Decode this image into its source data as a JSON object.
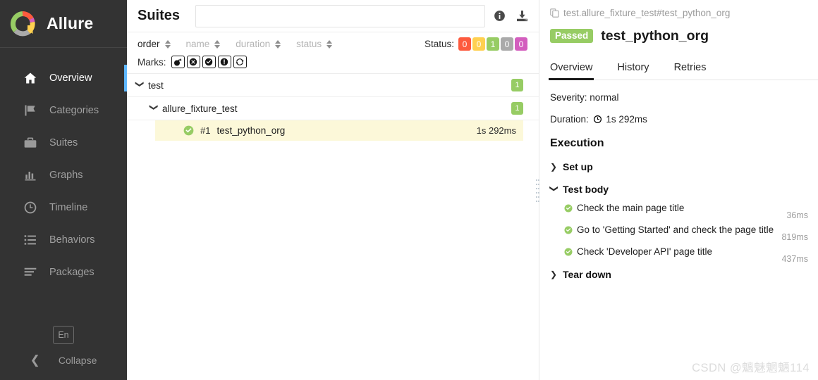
{
  "sidebar": {
    "brand": "Allure",
    "logo_colors": [
      "#97cc64",
      "#fd5a3e",
      "#d35ebe",
      "#ffd050",
      "#aaaaaa"
    ],
    "items": [
      {
        "label": "Overview",
        "icon": "home-icon",
        "active": false
      },
      {
        "label": "Categories",
        "icon": "flag-icon",
        "active": false
      },
      {
        "label": "Suites",
        "icon": "briefcase-icon",
        "active": true
      },
      {
        "label": "Graphs",
        "icon": "bar-chart-icon",
        "active": false
      },
      {
        "label": "Timeline",
        "icon": "clock-icon",
        "active": false
      },
      {
        "label": "Behaviors",
        "icon": "list-icon",
        "active": false
      },
      {
        "label": "Packages",
        "icon": "layers-icon",
        "active": false
      }
    ],
    "language_button": "En",
    "collapse_label": "Collapse",
    "collapse_icon": "chevron-left-icon",
    "active_indicator_color": "#5fb8ff"
  },
  "middle": {
    "title": "Suites",
    "search": {
      "value": "",
      "placeholder": ""
    },
    "info_icon": "info-circle-icon",
    "download_icon": "download-icon",
    "sorters": [
      {
        "label": "order",
        "active": true
      },
      {
        "label": "name",
        "active": false
      },
      {
        "label": "duration",
        "active": false
      },
      {
        "label": "status",
        "active": false
      }
    ],
    "status_label": "Status:",
    "status_badges": [
      {
        "count": "0",
        "color": "#fd5a3e",
        "name": "failed"
      },
      {
        "count": "0",
        "color": "#ffd050",
        "name": "broken"
      },
      {
        "count": "1",
        "color": "#97cc64",
        "name": "passed"
      },
      {
        "count": "0",
        "color": "#aaaaaa",
        "name": "skipped"
      },
      {
        "count": "0",
        "color": "#d35ebe",
        "name": "unknown"
      }
    ],
    "marks_label": "Marks:",
    "marks": [
      {
        "icon": "bomb-icon"
      },
      {
        "icon": "x-circle-icon"
      },
      {
        "icon": "check-circle-icon"
      },
      {
        "icon": "exclamation-circle-icon"
      },
      {
        "icon": "retry-icon"
      }
    ],
    "tree": {
      "suite": {
        "name": "test",
        "count": "1",
        "expanded": true
      },
      "child": {
        "name": "allure_fixture_test",
        "count": "1",
        "expanded": true
      },
      "leaf": {
        "index": "#1",
        "name": "test_python_org",
        "duration": "1s 292ms",
        "status": "passed",
        "selected": true
      }
    }
  },
  "detail": {
    "breadcrumb": "test.allure_fixture_test#test_python_org",
    "copy_icon": "copy-icon",
    "status_pill": "Passed",
    "status_pill_color": "#97cc64",
    "title": "test_python_org",
    "tabs": [
      {
        "label": "Overview",
        "active": true
      },
      {
        "label": "History",
        "active": false
      },
      {
        "label": "Retries",
        "active": false
      }
    ],
    "severity": "Severity: normal",
    "duration_label": "Duration:",
    "duration_value": "1s 292ms",
    "duration_icon": "clock-icon",
    "execution_heading": "Execution",
    "sections": [
      {
        "label": "Set up",
        "expanded": false,
        "chevron": "chevron-right-icon"
      },
      {
        "label": "Test body",
        "expanded": true,
        "chevron": "chevron-down-icon"
      },
      {
        "label": "Tear down",
        "expanded": false,
        "chevron": "chevron-right-icon"
      }
    ],
    "steps": [
      {
        "text": "Check the main page title",
        "duration": "36ms",
        "status": "passed"
      },
      {
        "text": "Go to 'Getting Started' and check the page title",
        "duration": "819ms",
        "status": "passed"
      },
      {
        "text": "Check 'Developer API' page title",
        "duration": "437ms",
        "status": "passed"
      }
    ]
  },
  "watermark": "CSDN @魑魅魍魉114"
}
